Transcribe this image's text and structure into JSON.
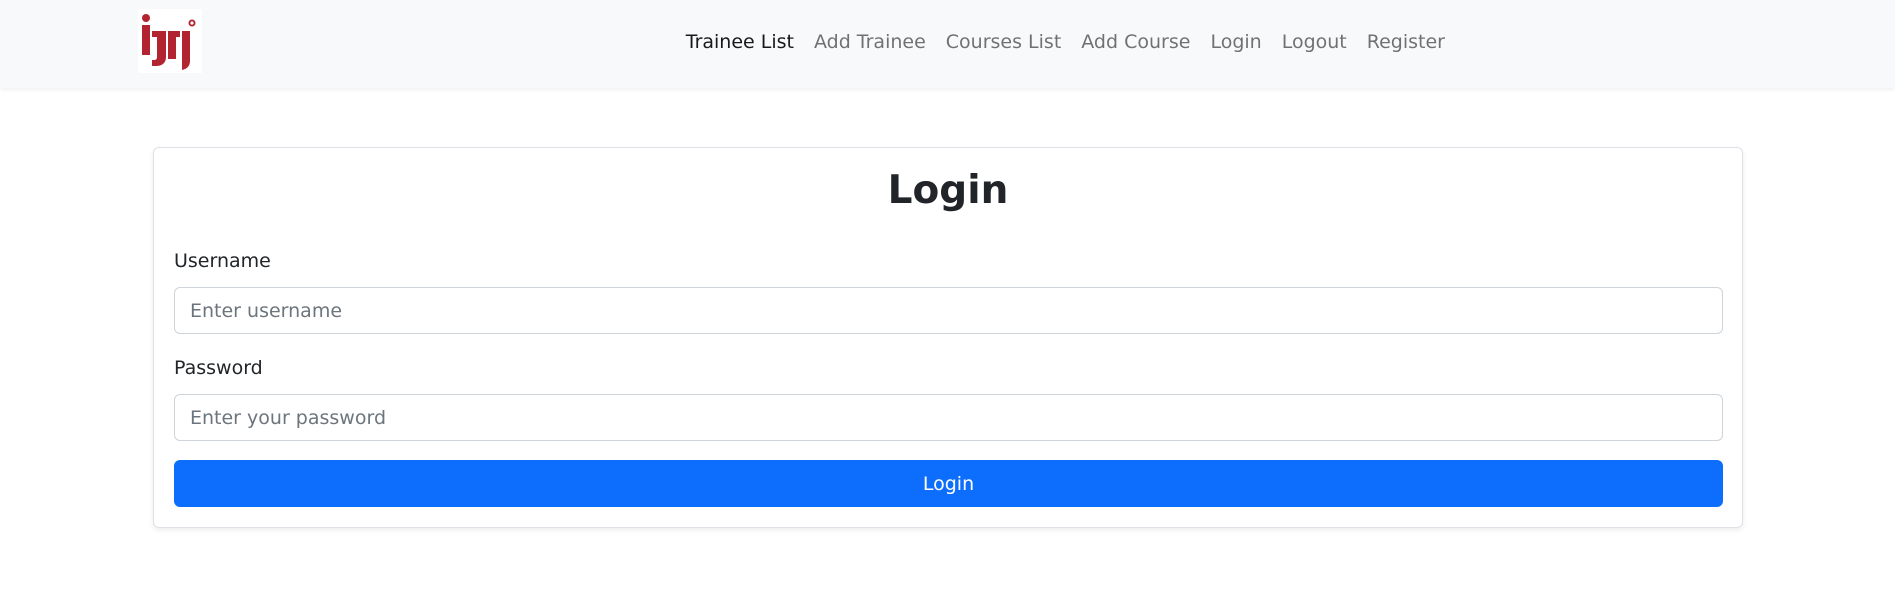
{
  "brand": {
    "logo_text": "iti",
    "logo_color": "#b22530",
    "logo_icon": "iti-logo-icon"
  },
  "nav": {
    "items": [
      {
        "label": "Trainee List",
        "active": true
      },
      {
        "label": "Add Trainee",
        "active": false
      },
      {
        "label": "Courses List",
        "active": false
      },
      {
        "label": "Add Course",
        "active": false
      },
      {
        "label": "Login",
        "active": false
      },
      {
        "label": "Logout",
        "active": false
      },
      {
        "label": "Register",
        "active": false
      }
    ]
  },
  "login_form": {
    "title": "Login",
    "username": {
      "label": "Username",
      "value": "",
      "placeholder": "Enter username"
    },
    "password": {
      "label": "Password",
      "value": "",
      "placeholder": "Enter your password"
    },
    "submit_label": "Login"
  },
  "colors": {
    "primary": "#0d6efd",
    "navbar_bg": "#f8f9fa",
    "nav_link": "rgba(0,0,0,0.55)",
    "nav_link_active": "rgba(0,0,0,0.9)"
  }
}
